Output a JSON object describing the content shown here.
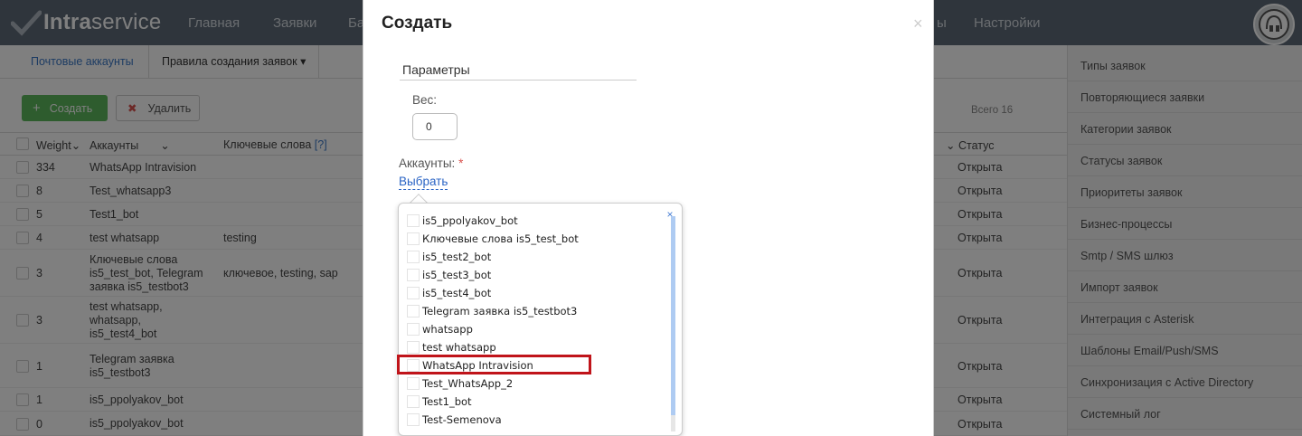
{
  "app": {
    "logo_text_a": "Intra",
    "logo_text_b": "service",
    "nav": [
      "Главная",
      "Заявки",
      "Ба",
      "ы",
      "Настройки"
    ]
  },
  "subtabs": {
    "mail_accounts": "Почтовые аккаунты",
    "rules": "Правила создания заявок"
  },
  "toolbar": {
    "create_label": "Создать",
    "delete_label": "Удалить",
    "total": "Всего 16"
  },
  "table": {
    "headers": {
      "weight": "Weight",
      "accounts": "Аккаунты",
      "keywords": "Ключевые слова",
      "keywords_help": "[?]",
      "status": "Статус"
    },
    "rows": [
      {
        "weight": "334",
        "accounts": [
          "WhatsApp Intravision"
        ],
        "keywords": "",
        "status": "Открыта"
      },
      {
        "weight": "8",
        "accounts": [
          "Test_whatsapp3"
        ],
        "keywords": "",
        "status": "Открыта"
      },
      {
        "weight": "5",
        "accounts": [
          "Test1_bot"
        ],
        "keywords": "",
        "status": "Открыта"
      },
      {
        "weight": "4",
        "accounts": [
          "test whatsapp"
        ],
        "keywords": "testing",
        "status": "Открыта"
      },
      {
        "weight": "3",
        "accounts": [
          "Ключевые слова",
          "is5_test_bot, Telegram",
          "заявка is5_testbot3"
        ],
        "keywords": "ключевое, testing, sap",
        "status": "Открыта"
      },
      {
        "weight": "3",
        "accounts": [
          "test whatsapp,",
          "whatsapp,",
          "is5_test4_bot"
        ],
        "keywords": "",
        "status": "Открыта"
      },
      {
        "weight": "1",
        "accounts": [
          "Telegram заявка",
          "is5_testbot3"
        ],
        "keywords": "",
        "status": "Открыта"
      },
      {
        "weight": "1",
        "accounts": [
          "is5_ppolyakov_bot"
        ],
        "keywords": "",
        "status": "Открыта"
      },
      {
        "weight": "0",
        "accounts": [
          "is5_ppolyakov_bot"
        ],
        "keywords": "",
        "status": "Открыта"
      }
    ]
  },
  "sidebar": {
    "items": [
      "Типы заявок",
      "Повторяющиеся заявки",
      "Категории заявок",
      "Статусы заявок",
      "Приоритеты заявок",
      "Бизнес-процессы",
      "Smtp / SMS шлюз",
      "Импорт заявок",
      "Интеграция с Asterisk",
      "Шаблоны Email/Push/SMS",
      "Синхронизация с Active Directory",
      "Системный лог"
    ]
  },
  "modal": {
    "title": "Создать",
    "close": "×",
    "section": "Параметры",
    "weight_label": "Вес:",
    "weight_value": "0",
    "accounts_label": "Аккаунты:",
    "required_mark": "*",
    "select_link": "Выбрать",
    "dropdown_close": "×",
    "options": [
      "is5_ppolyakov_bot",
      "Ключевые слова is5_test_bot",
      "is5_test2_bot",
      "is5_test3_bot",
      "is5_test4_bot",
      "Telegram заявка is5_testbot3",
      "whatsapp",
      "test whatsapp",
      "WhatsApp Intravision",
      "Test_WhatsApp_2",
      "Test1_bot",
      "Test-Semenova"
    ],
    "highlighted_option": "WhatsApp Intravision"
  },
  "colors": {
    "topbar": "#5e6b78",
    "create_button": "#5cb85c",
    "link": "#2a64c5",
    "highlight_border": "#c0141a"
  }
}
